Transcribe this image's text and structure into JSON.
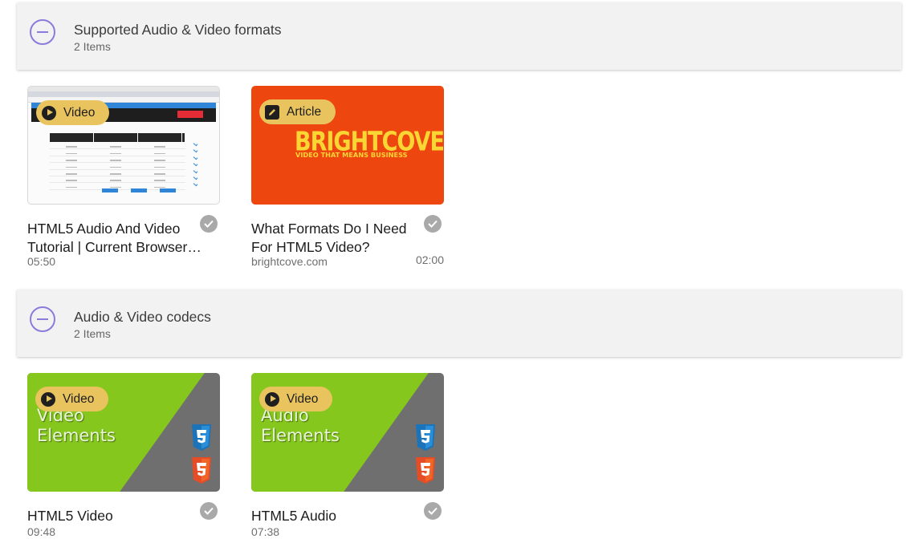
{
  "sections": [
    {
      "title": "Supported Audio & Video formats",
      "count": "2 Items",
      "items": [
        {
          "badge": "Video",
          "title": "HTML5 Audio And Video Tutorial | Current Browser…",
          "duration": "05:50"
        },
        {
          "badge": "Article",
          "title": "What Formats Do I Need For HTML5 Video?",
          "source": "brightcove.com",
          "duration": "02:00",
          "thumb_logo": "BRIGHTCOVE",
          "thumb_tagline": "VIDEO THAT MEANS BUSINESS"
        }
      ]
    },
    {
      "title": "Audio & Video codecs",
      "count": "2 Items",
      "items": [
        {
          "badge": "Video",
          "title": "HTML5 Video",
          "duration": "09:48",
          "thumb_text_1": "Video",
          "thumb_text_2": "Elements"
        },
        {
          "badge": "Video",
          "title": "HTML5 Audio",
          "duration": "07:38",
          "thumb_text_1": "Audio",
          "thumb_text_2": "Elements"
        }
      ]
    }
  ],
  "colors": {
    "accent": "#8a7bdc",
    "badge": "#e9c45e",
    "check": "#a9a9a9",
    "brightcove_bg": "#ee460f",
    "thumb_green": "#86c71e"
  },
  "icons": {
    "collapse": "minus-circle-icon",
    "video_badge": "play-circle-icon",
    "article_badge": "pencil-square-icon",
    "completed": "check-circle-icon",
    "css3": "css3-logo",
    "html5": "html5-logo"
  }
}
